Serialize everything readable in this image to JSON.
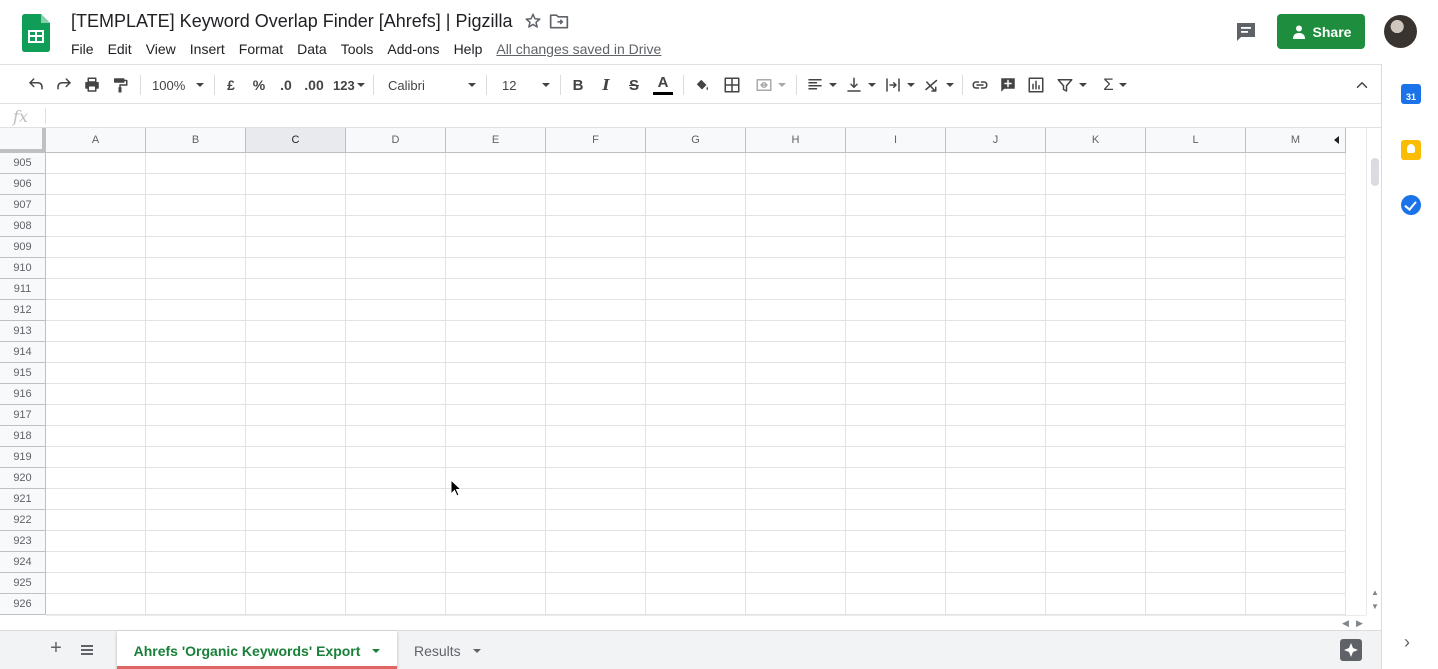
{
  "header": {
    "title": "[TEMPLATE] Keyword Overlap Finder [Ahrefs] | Pigzilla",
    "menus": [
      "File",
      "Edit",
      "View",
      "Insert",
      "Format",
      "Data",
      "Tools",
      "Add-ons",
      "Help"
    ],
    "save_status": "All changes saved in Drive",
    "share_label": "Share"
  },
  "toolbar": {
    "zoom": "100%",
    "currency": "£",
    "percent": "%",
    "decrease_decimal": ".0",
    "increase_decimal": ".00",
    "number_format": "123",
    "font": "Calibri",
    "font_size": "12",
    "bold": "B",
    "italic": "I",
    "strikethrough": "S",
    "text_color": "A",
    "sum": "Σ"
  },
  "formula_bar": {
    "fx": "fx",
    "value": ""
  },
  "grid": {
    "columns": [
      "A",
      "B",
      "C",
      "D",
      "E",
      "F",
      "G",
      "H",
      "I",
      "J",
      "K",
      "L",
      "M"
    ],
    "selected_column": "C",
    "rows": [
      "905",
      "906",
      "907",
      "908",
      "909",
      "910",
      "911",
      "912",
      "913",
      "914",
      "915",
      "916",
      "917",
      "918",
      "919",
      "920",
      "921",
      "922",
      "923",
      "924",
      "925",
      "926"
    ]
  },
  "sheets": {
    "active": "Ahrefs 'Organic Keywords' Export",
    "other": "Results",
    "active_tab_color": "#e06666"
  },
  "side_panel": {
    "calendar_label": "31"
  },
  "colors": {
    "share_green": "#1e8e3e",
    "active_tab_text": "#188038",
    "sheets_logo": "#0f9d58"
  }
}
